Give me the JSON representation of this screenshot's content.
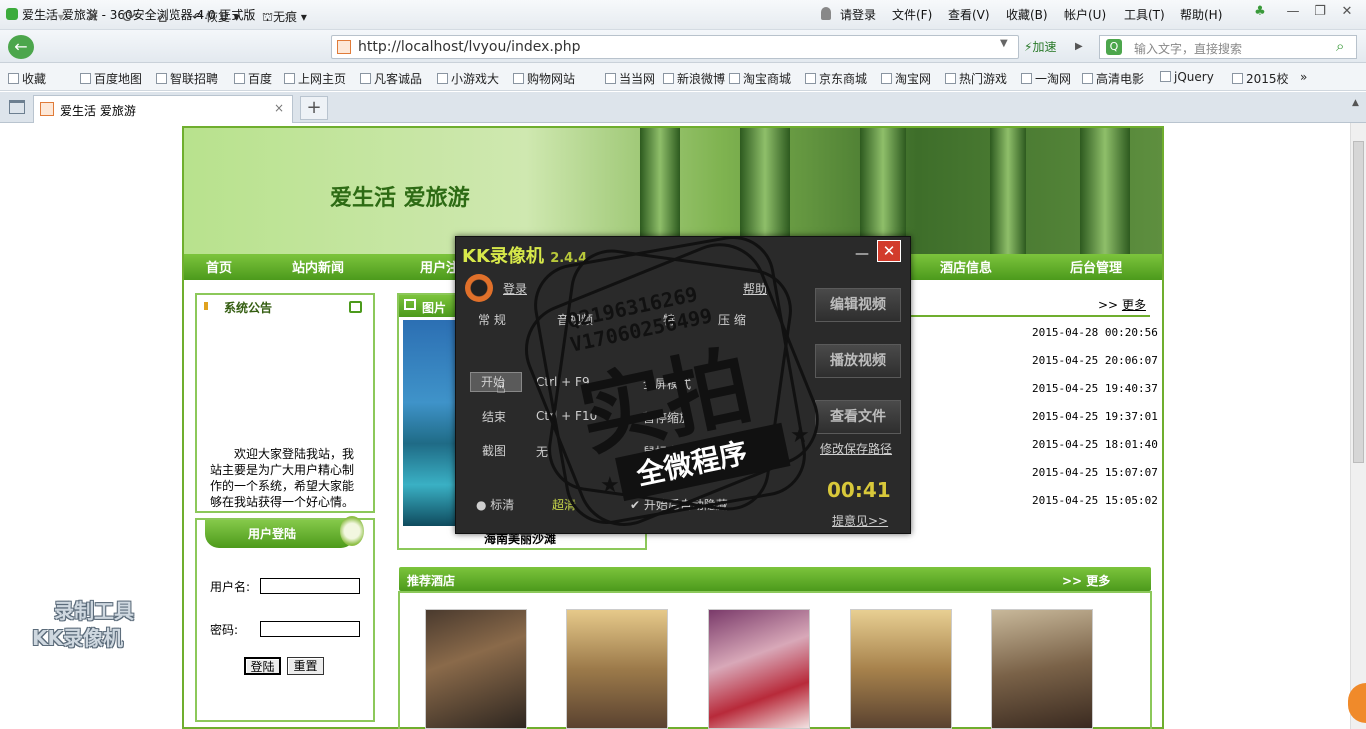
{
  "browser": {
    "title": "爱生活 爱旅游 - 360安全浏览器 4.0 正式版",
    "menu": [
      "请登录",
      "文件(F)",
      "查看(V)",
      "收藏(B)",
      "帐户(U)",
      "工具(T)",
      "帮助(H)"
    ],
    "nav": {
      "restore": "恢复",
      "trace": "无痕",
      "accelerate": "加速"
    },
    "url": "http://localhost/lvyou/index.php",
    "search_placeholder": "输入文字，直接搜索",
    "bookmarks": [
      "收藏",
      "百度地图",
      "智联招聘",
      "百度",
      "上网主页",
      "凡客诚品",
      "小游戏大",
      "购物网站",
      "当当网",
      "新浪微博",
      "淘宝商城",
      "京东商城",
      "淘宝网",
      "热门游戏",
      "一淘网",
      "高清电影",
      "jQuery",
      "2015校"
    ],
    "tab_title": "爱生活 爱旅游"
  },
  "site": {
    "title": "爱生活  爱旅游",
    "nav": [
      "首页",
      "站内新闻",
      "用户注",
      "酒店信息",
      "后台管理"
    ],
    "notice": {
      "title": "系统公告",
      "text": "欢迎大家登陆我站，我站主要是为广大用户精心制作的一个系统，希望大家能够在我站获得一个好心情。"
    },
    "login": {
      "title": "用户登陆",
      "username_label": "用户名:",
      "password_label": "密码:",
      "login_btn": "登陆",
      "reset_btn": "重置"
    },
    "pictures": {
      "title": "图片",
      "caption": "海南美丽沙滩"
    },
    "news": {
      "more": "更多",
      "dates": [
        "2015-04-28 00:20:56",
        "2015-04-25 20:06:07",
        "2015-04-25 19:40:37",
        "2015-04-25 19:37:01",
        "2015-04-25 18:01:40",
        "2015-04-25 15:07:07",
        "2015-04-25 15:05:02"
      ]
    },
    "hotels": {
      "title": "推荐酒店",
      "more": "更多"
    }
  },
  "recorder": {
    "title": "KK录像机",
    "version": "2.4.4",
    "login": "登录",
    "help": "帮助",
    "tabs": [
      "常  规",
      "音视频",
      "特",
      "压  缩"
    ],
    "rows": [
      "开始",
      "暂停",
      "结束",
      "截图"
    ],
    "hotkeys": [
      "Ctrl + F9",
      "Ctrl + F10",
      "无"
    ],
    "options": [
      "全屏模式",
      "暂停缩放",
      "鼠标高亮"
    ],
    "quality": [
      "标清",
      "超清"
    ],
    "auto_hide": "开始后自动隐藏",
    "buttons": [
      "编辑视频",
      "播放视频",
      "查看文件"
    ],
    "save_path": "修改保存路径",
    "timer": "00:41",
    "feedback": "提意见>>"
  },
  "stamp": {
    "qq": "Q2196316269",
    "v": "V17060256499",
    "main": "实拍",
    "sub": "全微程序"
  },
  "watermark": [
    "录制工具",
    "KK录像机"
  ],
  "colors": {
    "site_green": "#6fae2e",
    "nav_green": "#4c9a1c",
    "recorder_dark": "#2a2a2a"
  }
}
